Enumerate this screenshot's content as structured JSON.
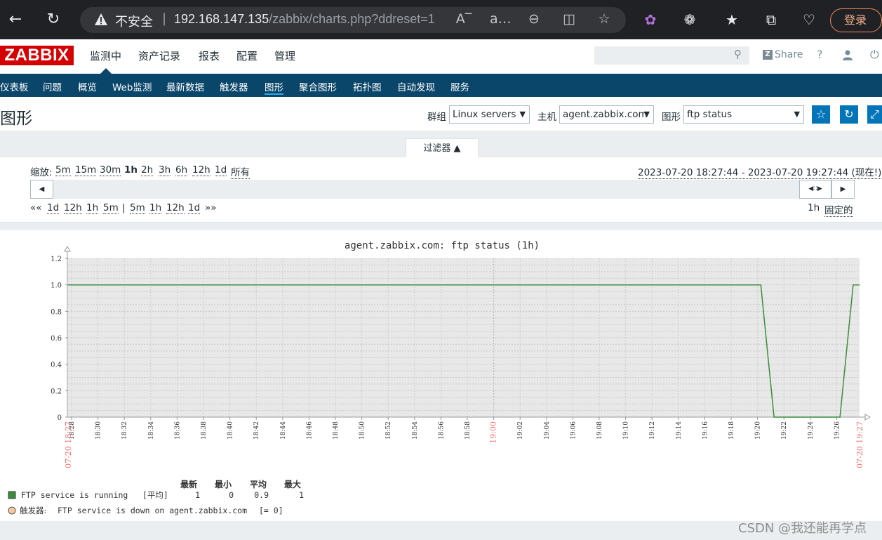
{
  "browser": {
    "security_label": "不安全",
    "url_main": "192.168.147.135",
    "url_rest": "/zabbix/charts.php?ddreset=1",
    "login_label": "登录"
  },
  "header": {
    "logo": "ZABBIX",
    "main_nav": [
      "监测中",
      "资产记录",
      "报表",
      "配置",
      "管理"
    ],
    "share_label": "Share",
    "help_label": "?"
  },
  "subnav": [
    "仪表板",
    "问题",
    "概览",
    "Web监测",
    "最新数据",
    "触发器",
    "图形",
    "聚合图形",
    "拓扑图",
    "自动发现",
    "服务"
  ],
  "page": {
    "title": "图形",
    "group_label": "群组",
    "group_value": "Linux servers",
    "host_label": "主机",
    "host_value": "agent.zabbix.com",
    "graph_label": "图形",
    "graph_value": "ftp status"
  },
  "filter": {
    "tab_label": "过滤器 ▲",
    "zoom_label": "缩放:",
    "zoom_options": [
      "5m",
      "15m",
      "30m",
      "1h",
      "2h",
      "3h",
      "6h",
      "12h",
      "1d",
      "所有"
    ],
    "zoom_selected": "1h",
    "range_text": "2023-07-20 18:27:44 - 2023-07-20 19:27:44 (现在!)",
    "nav_prev": "««",
    "nav_back": [
      "1d",
      "12h",
      "1h",
      "5m"
    ],
    "nav_sep": "|",
    "nav_fwd": [
      "5m",
      "1h",
      "12h",
      "1d"
    ],
    "nav_next": "»»",
    "period": "1h",
    "fixed_label": "固定的"
  },
  "chart_data": {
    "type": "line",
    "title": "agent.zabbix.com: ftp status (1h)",
    "ylim": [
      0,
      1.2
    ],
    "yticks": [
      "1.2",
      "1.0",
      "0.8",
      "0.6",
      "0.4",
      "0.2",
      "0"
    ],
    "xticks": [
      "18:28",
      "18:30",
      "18:32",
      "18:34",
      "18:36",
      "18:38",
      "18:40",
      "18:42",
      "18:44",
      "18:46",
      "18:48",
      "18:50",
      "18:52",
      "18:54",
      "18:56",
      "18:58",
      "19:00",
      "19:02",
      "19:04",
      "19:06",
      "19:08",
      "19:10",
      "19:12",
      "19:14",
      "19:16",
      "19:18",
      "19:20",
      "19:22",
      "19:24",
      "19:26"
    ],
    "x_start_label": "07-20 18:27",
    "x_end_label": "07-20 19:27",
    "series": [
      {
        "name": "FTP service is running",
        "color": "#3c8c3c",
        "x": [
          "18:27:44",
          "19:20:15",
          "19:21:15",
          "19:26:15",
          "19:27:15",
          "19:27:44"
        ],
        "values": [
          1,
          1,
          0,
          0,
          1,
          1
        ]
      }
    ],
    "legend": {
      "headers": [
        "最新",
        "最小",
        "平均",
        "最大"
      ],
      "item_label": "FTP service is running",
      "item_func": "[平均]",
      "item_stats": [
        "1",
        "0",
        "0.9",
        "1"
      ],
      "trigger_prefix": "触发器:",
      "trigger_text": "FTP service is down on agent.zabbix.com",
      "trigger_cond": "[= 0]"
    },
    "colors": {
      "grid_bg": "#e8e8e8",
      "line": "#3c8c3c",
      "trigger": "#f8c8a0",
      "red_labels": "#f07070"
    }
  },
  "watermark": "CSDN @我还能再学点"
}
